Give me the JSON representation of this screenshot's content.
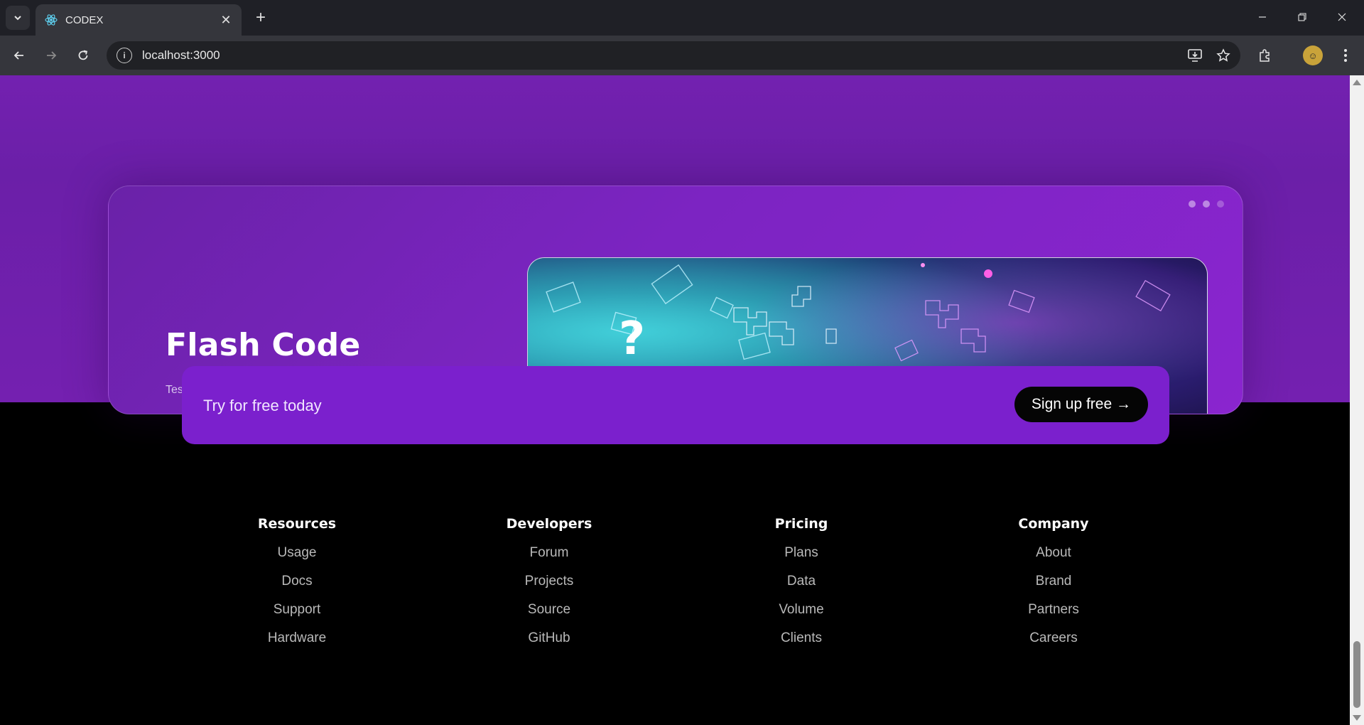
{
  "browser": {
    "tab_title": "CODEX",
    "tab_close": "✕",
    "new_tab": "+",
    "url": "localhost:3000",
    "icons": {
      "tab_search": "chevron-down-icon",
      "favicon": "react-icon",
      "back": "arrow-left-icon",
      "forward": "arrow-right-icon",
      "reload": "reload-icon",
      "site_info": "info-icon",
      "install": "install-app-icon",
      "bookmark": "star-icon",
      "extensions": "puzzle-icon",
      "menu": "kebab-menu-icon"
    }
  },
  "hero": {
    "title": "Flash Code",
    "description": "Tes",
    "carousel_dots": 3,
    "active_dot": 0
  },
  "cta": {
    "text": "Try for free today",
    "button_label": "Sign up free →"
  },
  "footer": {
    "columns": [
      {
        "heading": "Resources",
        "links": [
          "Usage",
          "Docs",
          "Support",
          "Hardware"
        ]
      },
      {
        "heading": "Developers",
        "links": [
          "Forum",
          "Projects",
          "Source",
          "GitHub"
        ]
      },
      {
        "heading": "Pricing",
        "links": [
          "Plans",
          "Data",
          "Volume",
          "Clients"
        ]
      },
      {
        "heading": "Company",
        "links": [
          "About",
          "Brand",
          "Partners",
          "Careers"
        ]
      }
    ]
  },
  "colors": {
    "hero_bg": "#7321b0",
    "cta_bg": "#7b20cd",
    "cta_button": "#050505",
    "footer_bg": "#000000"
  }
}
